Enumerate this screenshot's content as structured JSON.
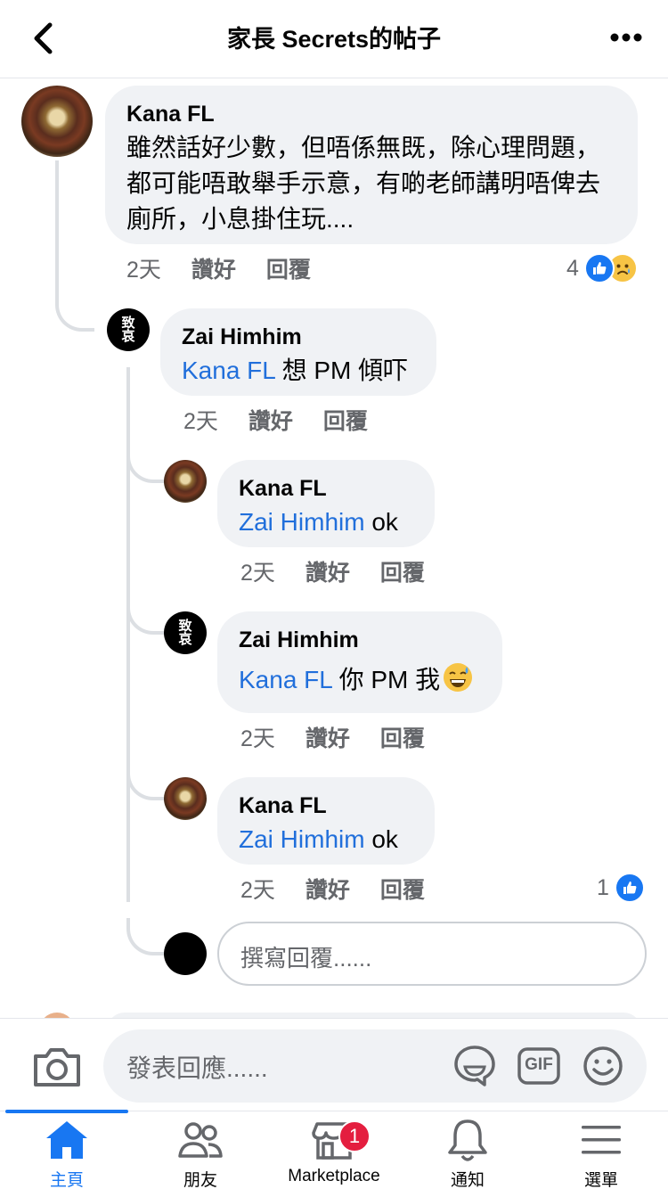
{
  "header": {
    "title": "家長 Secrets的帖子"
  },
  "comments": [
    {
      "author": "Kana FL",
      "mention": "",
      "text": "雖然話好少數，但唔係無既，除心理問題，都可能唔敢舉手示意，有啲老師講明唔俾去廁所，小息掛住玩....",
      "time": "2天",
      "like_label": "讚好",
      "reply_label": "回覆",
      "reaction_count": "4"
    },
    {
      "author": "Zai Himhim",
      "mention": "Kana FL",
      "text": " 想 PM 傾吓",
      "time": "2天",
      "like_label": "讚好",
      "reply_label": "回覆"
    },
    {
      "author": "Kana FL",
      "mention": "Zai Himhim",
      "text": " ok",
      "time": "2天",
      "like_label": "讚好",
      "reply_label": "回覆"
    },
    {
      "author": "Zai Himhim",
      "mention": "Kana FL",
      "text": " 你 PM 我",
      "time": "2天",
      "like_label": "讚好",
      "reply_label": "回覆"
    },
    {
      "author": "Kana FL",
      "mention": "Zai Himhim",
      "text": " ok",
      "time": "2天",
      "like_label": "讚好",
      "reply_label": "回覆",
      "reaction_count": "1"
    }
  ],
  "avatar_text": {
    "zai_top": "致",
    "zai_bottom": "哀"
  },
  "reply_input": {
    "placeholder": "撰寫回覆......"
  },
  "composer": {
    "placeholder": "發表回應......",
    "gif_label": "GIF"
  },
  "tabbar": {
    "home": "主頁",
    "friends": "朋友",
    "marketplace": "Marketplace",
    "marketplace_badge": "1",
    "notifications": "通知",
    "menu": "選單"
  },
  "colors": {
    "accent": "#1877f2",
    "mention": "#216fdb",
    "bubble": "#f0f2f5",
    "badge": "#e41e3f"
  },
  "icons": {
    "back": "chevron-left-icon",
    "more": "more-dots-icon",
    "like": "thumbs-up-icon",
    "sad": "sad-emoji-icon",
    "camera": "camera-icon",
    "sticker": "sticker-icon",
    "gif": "gif-icon",
    "emoji": "smiley-icon",
    "home": "home-icon",
    "friends": "friends-icon",
    "marketplace": "store-icon",
    "notifications": "bell-icon",
    "menu": "hamburger-icon"
  }
}
